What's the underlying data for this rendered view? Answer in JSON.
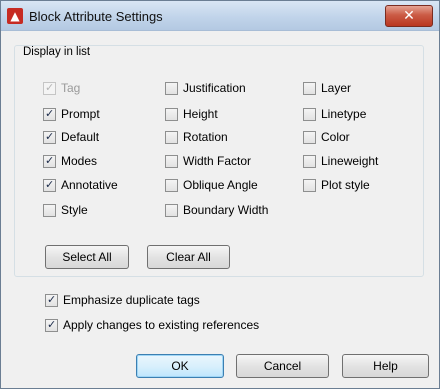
{
  "window": {
    "title": "Block Attribute Settings",
    "close_glyph": "✕"
  },
  "group": {
    "legend": "Display in list"
  },
  "columns": {
    "col1": [
      {
        "label": "Tag",
        "checked": true,
        "disabled": true
      },
      {
        "label": "Prompt",
        "checked": true,
        "disabled": false
      },
      {
        "label": "Default",
        "checked": true,
        "disabled": false
      },
      {
        "label": "Modes",
        "checked": true,
        "disabled": false
      },
      {
        "label": "Annotative",
        "checked": true,
        "disabled": false
      },
      {
        "label": "Style",
        "checked": false,
        "disabled": false
      }
    ],
    "col2": [
      {
        "label": "Justification",
        "checked": false
      },
      {
        "label": "Height",
        "checked": false
      },
      {
        "label": "Rotation",
        "checked": false
      },
      {
        "label": "Width Factor",
        "checked": false
      },
      {
        "label": "Oblique Angle",
        "checked": false
      },
      {
        "label": "Boundary Width",
        "checked": false
      }
    ],
    "col3": [
      {
        "label": "Layer",
        "checked": false
      },
      {
        "label": "Linetype",
        "checked": false
      },
      {
        "label": "Color",
        "checked": false
      },
      {
        "label": "Lineweight",
        "checked": false
      },
      {
        "label": "Plot style",
        "checked": false
      }
    ]
  },
  "buttons": {
    "select_all": "Select All",
    "clear_all": "Clear All",
    "ok": "OK",
    "cancel": "Cancel",
    "help": "Help"
  },
  "options": {
    "emphasize": {
      "label": "Emphasize duplicate tags",
      "checked": true
    },
    "apply": {
      "label": "Apply changes to existing references",
      "checked": true
    }
  },
  "colors": {
    "title_bar": "#c1d4ea",
    "close_button": "#cb5b45",
    "app_icon": "#c62b23",
    "default_button_border": "#3c7fb1"
  }
}
